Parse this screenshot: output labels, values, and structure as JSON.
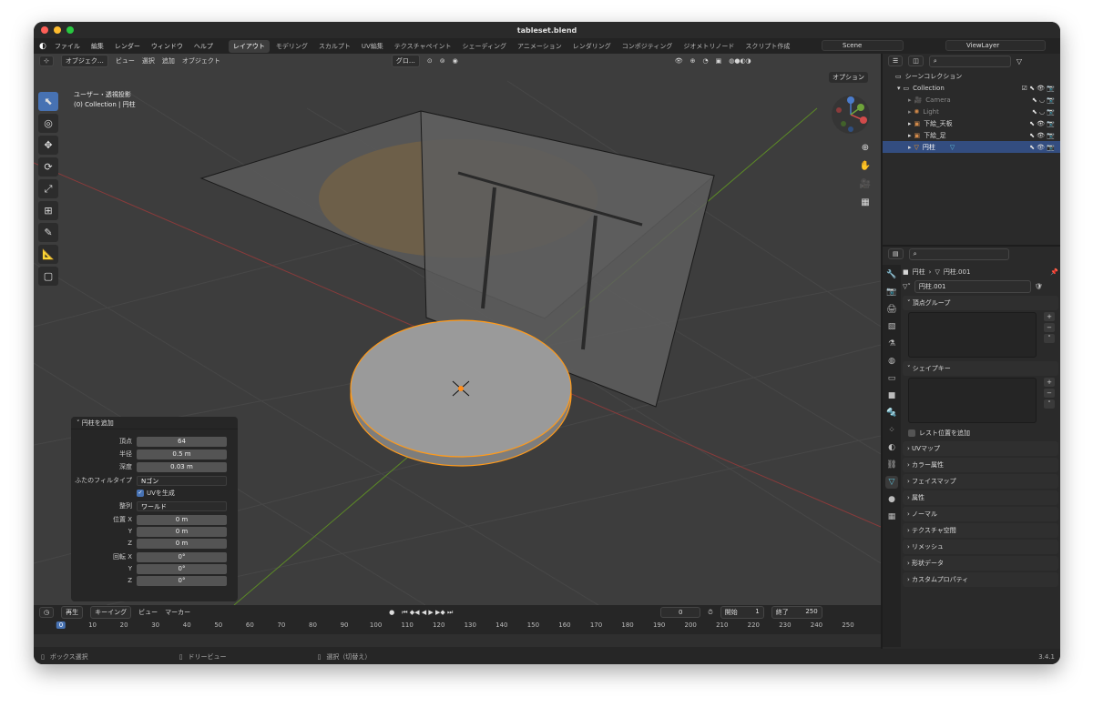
{
  "window": {
    "title": "tableset.blend"
  },
  "menu": {
    "items": [
      "ファイル",
      "編集",
      "レンダー",
      "ウィンドウ",
      "ヘルプ"
    ],
    "workspaces": [
      "レイアウト",
      "モデリング",
      "スカルプト",
      "UV編集",
      "テクスチャペイント",
      "シェーディング",
      "アニメーション",
      "レンダリング",
      "コンポジティング",
      "ジオメトリノード",
      "スクリプト作成"
    ],
    "active_workspace": "レイアウト",
    "scene": "Scene",
    "view_layer": "ViewLayer"
  },
  "viewport": {
    "mode": "オブジェク…",
    "menus": [
      "ビュー",
      "選択",
      "追加",
      "オブジェクト"
    ],
    "orientation": "グロ…",
    "options_label": "オプション",
    "view_name": "ユーザー・透視投影",
    "collection_info": "(0) Collection | 円柱"
  },
  "operator_panel": {
    "title": "円柱を追加",
    "rows": [
      {
        "label": "頂点",
        "value": "64"
      },
      {
        "label": "半径",
        "value": "0.5 m"
      },
      {
        "label": "深度",
        "value": "0.03 m"
      },
      {
        "label": "ふたのフィルタイプ",
        "value": "Nゴン"
      },
      {
        "label": "",
        "value": "UVを生成"
      },
      {
        "label": "整列",
        "value": "ワールド"
      },
      {
        "label": "位置 X",
        "value": "0 m"
      },
      {
        "label": "Y",
        "value": "0 m"
      },
      {
        "label": "Z",
        "value": "0 m"
      },
      {
        "label": "回転 X",
        "value": "0°"
      },
      {
        "label": "Y",
        "value": "0°"
      },
      {
        "label": "Z",
        "value": "0°"
      }
    ]
  },
  "timeline": {
    "menus": [
      "再生",
      "キーイング",
      "ビュー",
      "マーカー"
    ],
    "current_frame": "0",
    "start_label": "開始",
    "start": "1",
    "end_label": "終了",
    "end": "250",
    "ticks": [
      "0",
      "10",
      "20",
      "30",
      "40",
      "50",
      "60",
      "70",
      "80",
      "90",
      "100",
      "110",
      "120",
      "130",
      "140",
      "150",
      "160",
      "170",
      "180",
      "190",
      "200",
      "210",
      "220",
      "230",
      "240",
      "250"
    ]
  },
  "statusbar": {
    "left": "ボックス選択",
    "middle": "ドリービュー",
    "right": "選択（切替え）",
    "version": "3.4.1"
  },
  "outliner": {
    "root": "シーンコレクション",
    "collection": "Collection",
    "items": [
      {
        "name": "Camera"
      },
      {
        "name": "Light"
      },
      {
        "name": "下絵_天板"
      },
      {
        "name": "下絵_足"
      },
      {
        "name": "円柱"
      }
    ]
  },
  "properties": {
    "breadcrumb_object": "円柱",
    "breadcrumb_data": "円柱.001",
    "mesh_name": "円柱.001",
    "panels": {
      "vertex_groups": "頂点グループ",
      "shape_keys": "シェイプキー",
      "relative_to_rest": "レスト位置を追加",
      "collapsed": [
        "UVマップ",
        "カラー属性",
        "フェイスマップ",
        "属性",
        "ノーマル",
        "テクスチャ空間",
        "リメッシュ",
        "形状データ",
        "カスタムプロパティ"
      ]
    }
  }
}
